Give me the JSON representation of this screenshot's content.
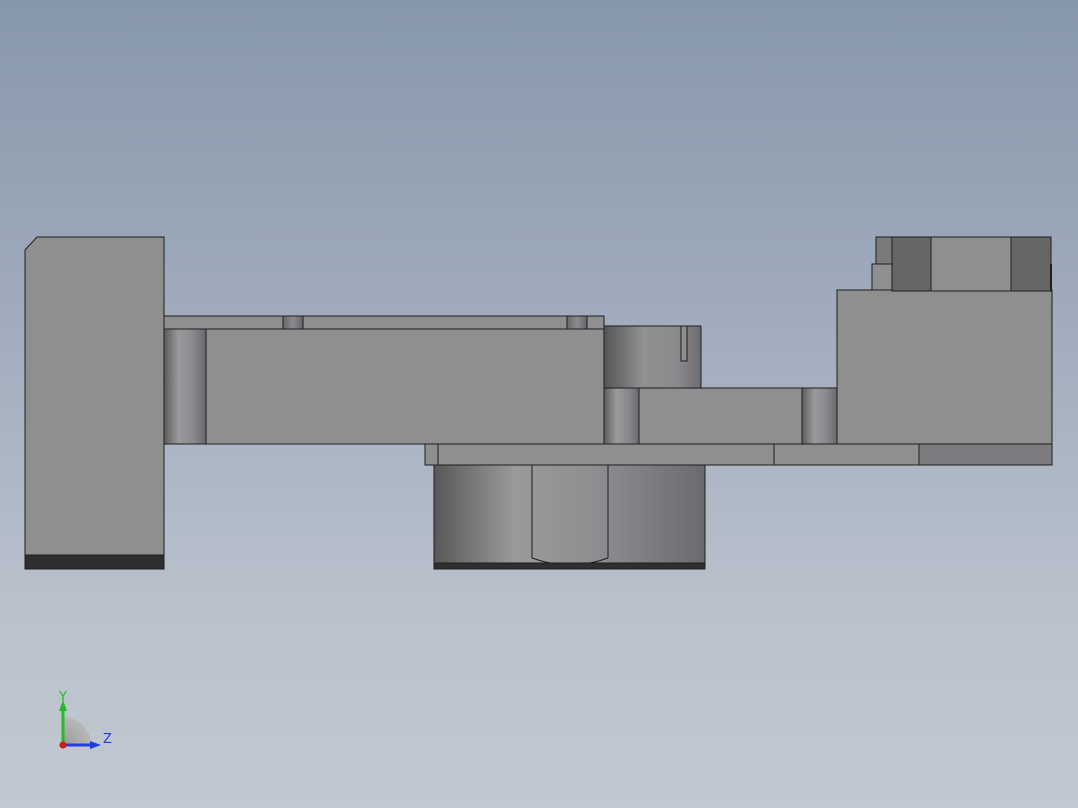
{
  "triad": {
    "y_label": "Y",
    "z_label": "Z",
    "y_color": "#22bb22",
    "z_color": "#1f3fd8",
    "x_color": "#d01818"
  },
  "colors": {
    "body_gray": "#8f8f8f",
    "edge": "#1e1e1e",
    "dark_band": "#2f2f2f",
    "dark_face": "#666666",
    "mauve_face": "#7d7a80"
  }
}
